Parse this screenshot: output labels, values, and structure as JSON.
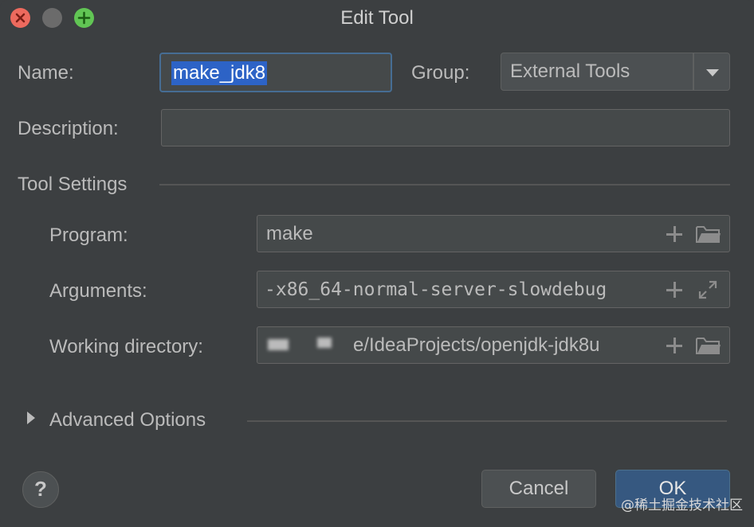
{
  "window": {
    "title": "Edit Tool"
  },
  "form": {
    "name_label": "Name:",
    "name_value": "make_jdk8",
    "group_label": "Group:",
    "group_value": "External Tools",
    "description_label": "Description:",
    "description_value": ""
  },
  "tool_settings": {
    "section_label": "Tool Settings",
    "program_label": "Program:",
    "program_value": "make",
    "arguments_label": "Arguments:",
    "arguments_value": "-x86_64-normal-server-slowdebug",
    "working_dir_label": "Working directory:",
    "working_dir_value": "e/IdeaProjects/openjdk-jdk8u"
  },
  "advanced": {
    "label": "Advanced Options"
  },
  "buttons": {
    "help": "?",
    "cancel": "Cancel",
    "ok": "OK"
  },
  "watermark": "@稀土掘金技术社区",
  "colors": {
    "background": "#3c3f41",
    "selection": "#2d63c6",
    "focus_border": "#466d94",
    "ok_button": "#365880",
    "close": "#ed6a5e",
    "maximize": "#61c554"
  },
  "icons": {
    "add": "plus-icon",
    "browse": "folder-icon",
    "expand": "expand-icon",
    "advanced_toggle": "chevron-right-icon"
  }
}
